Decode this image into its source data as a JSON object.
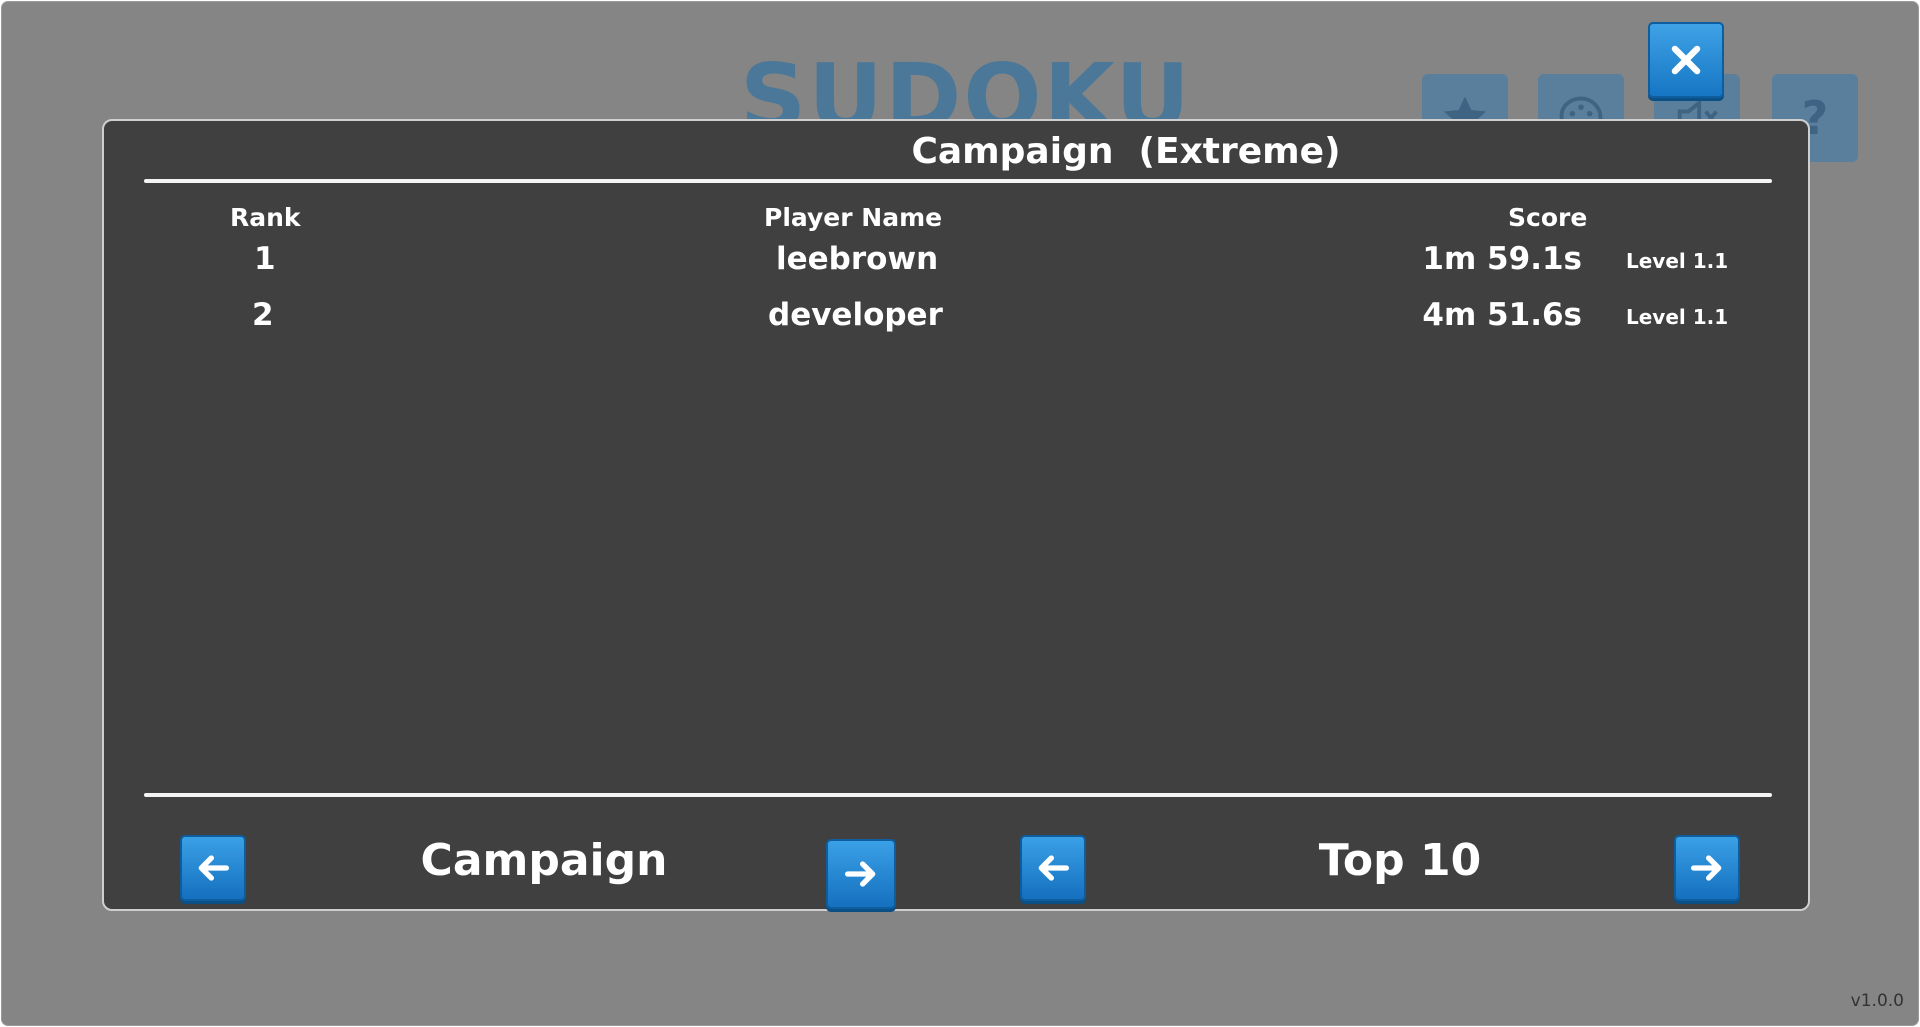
{
  "background": {
    "title": "SUDOKU",
    "buttons": [
      {
        "icon": "star-icon"
      },
      {
        "icon": "palette-icon"
      },
      {
        "icon": "sound-muted-icon"
      },
      {
        "icon": "help-icon",
        "glyph": "?"
      }
    ]
  },
  "close_button": {
    "icon": "close-icon"
  },
  "dialog": {
    "title": "Campaign  (Extreme)",
    "columns": {
      "rank": "Rank",
      "player": "Player Name",
      "score": "Score"
    },
    "rows": [
      {
        "rank": "1",
        "player": "leebrown",
        "score": "1m 59.1s",
        "level": "Level 1.1"
      },
      {
        "rank": "2",
        "player": "developer",
        "score": "4m 51.6s",
        "level": "Level 1.1"
      }
    ],
    "footer": {
      "mode_label": "Campaign",
      "range_label": "Top 10"
    }
  },
  "version": "v1.0.0",
  "colors": {
    "accent": "#1b7ccc",
    "dialog_bg": "#404040",
    "overlay_bg": "#858585"
  }
}
